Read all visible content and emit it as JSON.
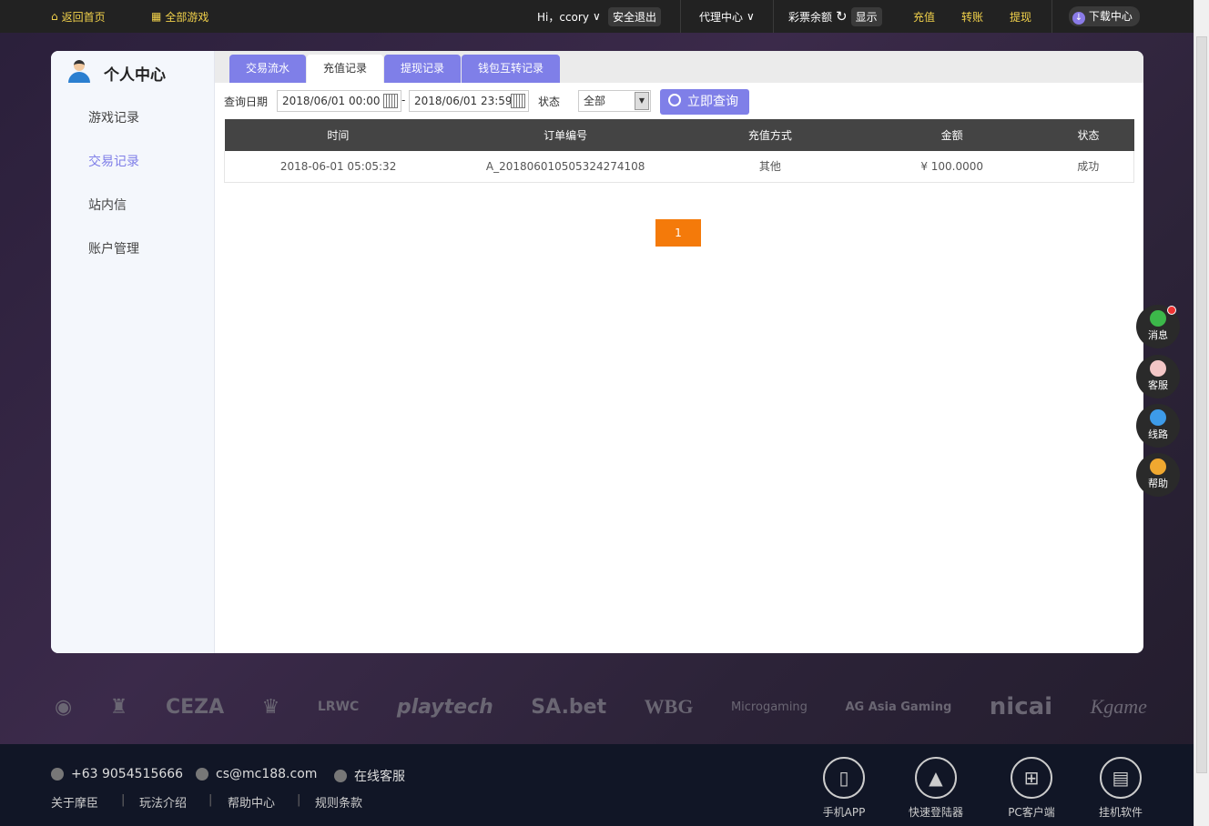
{
  "topbar": {
    "home": "返回首页",
    "all_games": "全部游戏",
    "greeting": "Hi，ccory",
    "logout": "安全退出",
    "agent": "代理中心",
    "balance_label": "彩票余额",
    "show": "显示",
    "deposit": "充值",
    "transfer": "转账",
    "withdraw": "提现",
    "download": "下载中心"
  },
  "sidebar": {
    "title": "个人中心",
    "items": [
      {
        "label": "游戏记录"
      },
      {
        "label": "交易记录",
        "active": true
      },
      {
        "label": "站内信"
      },
      {
        "label": "账户管理"
      }
    ]
  },
  "tabs": [
    {
      "label": "交易流水"
    },
    {
      "label": "充值记录",
      "active": true
    },
    {
      "label": "提现记录"
    },
    {
      "label": "钱包互转记录"
    }
  ],
  "filter": {
    "date_label": "查询日期",
    "start": "2018/06/01 00:00",
    "dash": "-",
    "end": "2018/06/01 23:59",
    "status_label": "状态",
    "status_value": "全部",
    "search": "立即查询"
  },
  "table": {
    "headers": [
      "时间",
      "订单编号",
      "充值方式",
      "金额",
      "状态"
    ],
    "rows": [
      [
        "2018-06-01 05:05:32",
        "A_201806010505324274108",
        "其他",
        "¥ 100.0000",
        "成功"
      ]
    ]
  },
  "pagination": {
    "current": "1"
  },
  "partners": [
    "CEZA",
    "LRWC",
    "playtech",
    "SA.bet",
    "WBG",
    "Microgaming",
    "AG Asia Gaming",
    "nicai",
    "Kgame"
  ],
  "footer": {
    "phone": "+63 9054515666",
    "email": "cs@mc188.com",
    "support": "在线客服",
    "links": [
      "关于摩臣",
      "玩法介绍",
      "帮助中心",
      "规则条款"
    ],
    "downloads": [
      "手机APP",
      "快速登陆器",
      "PC客户端",
      "挂机软件"
    ]
  },
  "float": [
    "消息",
    "客服",
    "线路",
    "帮助"
  ],
  "colors": {
    "accent": "#7f7fe8",
    "page": "#f47a0a",
    "link": "#f2d24b"
  }
}
